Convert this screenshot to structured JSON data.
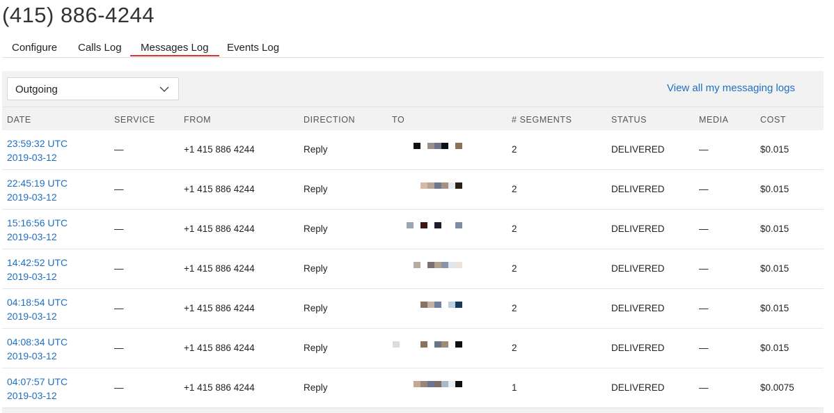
{
  "header": {
    "phone_number": "(415) 886-4244"
  },
  "tabs": [
    {
      "label": "Configure",
      "active": false
    },
    {
      "label": "Calls Log",
      "active": false
    },
    {
      "label": "Messages Log",
      "active": true
    },
    {
      "label": "Events Log",
      "active": false
    }
  ],
  "filter": {
    "selected": "Outgoing",
    "icon": "chevron-down-icon"
  },
  "links": {
    "view_all": "View all my messaging logs"
  },
  "columns": [
    "DATE",
    "SERVICE",
    "FROM",
    "DIRECTION",
    "TO",
    "# SEGMENTS",
    "STATUS",
    "MEDIA",
    "COST"
  ],
  "rows": [
    {
      "time": "23:59:32 UTC",
      "date": "2019-03-12",
      "service": "—",
      "from": "+1 415 886 4244",
      "direction": "Reply",
      "segments": "2",
      "status": "DELIVERED",
      "media": "—",
      "cost": "$0.015"
    },
    {
      "time": "22:45:19 UTC",
      "date": "2019-03-12",
      "service": "—",
      "from": "+1 415 886 4244",
      "direction": "Reply",
      "segments": "2",
      "status": "DELIVERED",
      "media": "—",
      "cost": "$0.015"
    },
    {
      "time": "15:16:56 UTC",
      "date": "2019-03-12",
      "service": "—",
      "from": "+1 415 886 4244",
      "direction": "Reply",
      "segments": "2",
      "status": "DELIVERED",
      "media": "—",
      "cost": "$0.015"
    },
    {
      "time": "14:42:52 UTC",
      "date": "2019-03-12",
      "service": "—",
      "from": "+1 415 886 4244",
      "direction": "Reply",
      "segments": "2",
      "status": "DELIVERED",
      "media": "—",
      "cost": "$0.015"
    },
    {
      "time": "04:18:54 UTC",
      "date": "2019-03-12",
      "service": "—",
      "from": "+1 415 886 4244",
      "direction": "Reply",
      "segments": "2",
      "status": "DELIVERED",
      "media": "—",
      "cost": "$0.015"
    },
    {
      "time": "04:08:34 UTC",
      "date": "2019-03-12",
      "service": "—",
      "from": "+1 415 886 4244",
      "direction": "Reply",
      "segments": "2",
      "status": "DELIVERED",
      "media": "—",
      "cost": "$0.015"
    },
    {
      "time": "04:07:57 UTC",
      "date": "2019-03-12",
      "service": "—",
      "from": "+1 415 886 4244",
      "direction": "Reply",
      "segments": "1",
      "status": "DELIVERED",
      "media": "—",
      "cost": "$0.0075"
    }
  ]
}
